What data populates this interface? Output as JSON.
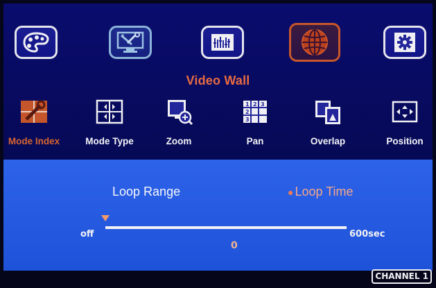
{
  "menu": {
    "title": "Video Wall",
    "tabs": [
      {
        "icon": "palette-icon"
      },
      {
        "icon": "monitor-tools-icon"
      },
      {
        "icon": "equalizer-icon"
      },
      {
        "icon": "globe-icon",
        "active": true
      },
      {
        "icon": "gear-icon"
      }
    ]
  },
  "submenu": {
    "items": [
      {
        "label": "Mode Index",
        "icon": "mode-index-icon",
        "selected": true
      },
      {
        "label": "Mode Type",
        "icon": "mode-type-icon"
      },
      {
        "label": "Zoom",
        "icon": "zoom-icon"
      },
      {
        "label": "Pan",
        "icon": "pan-grid-icon"
      },
      {
        "label": "Overlap",
        "icon": "overlap-icon"
      },
      {
        "label": "Position",
        "icon": "position-arrows-icon"
      }
    ]
  },
  "options": {
    "loop_range": "Loop Range",
    "loop_time": "Loop Time",
    "selected": "loop_time"
  },
  "slider": {
    "min_label": "off",
    "max_label": "600sec",
    "value": "0",
    "fraction": 0
  },
  "status": {
    "channel": "CHANNEL 1"
  },
  "colors": {
    "accent": "#e86b42",
    "panel": "#0a0c6e",
    "option_panel": "#2d63e9"
  }
}
